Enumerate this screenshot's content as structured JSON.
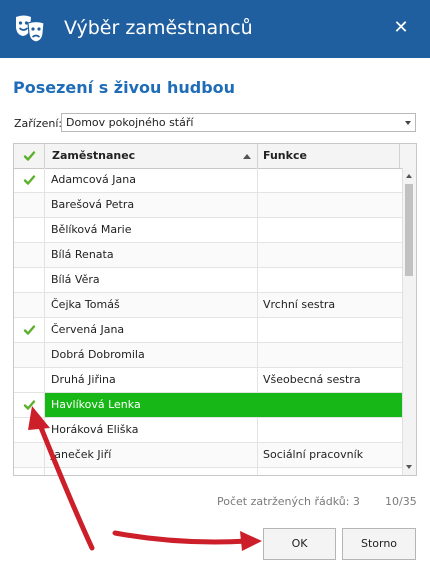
{
  "window": {
    "title": "Výběr zaměstnanců",
    "icon": "theater-masks-icon",
    "close_glyph": "✕"
  },
  "heading": "Posezení s živou hudbou",
  "facility": {
    "label": "Zařízení:",
    "value": "Domov pokojného stáří"
  },
  "table": {
    "columns": {
      "check": "✔",
      "name": "Zaměstnanec",
      "function": "Funkce"
    },
    "sort": {
      "column": "Zaměstnanec",
      "direction": "ascending"
    },
    "rows": [
      {
        "checked": true,
        "name": "Adamcová Jana",
        "function": ""
      },
      {
        "checked": false,
        "name": "Barešová Petra",
        "function": ""
      },
      {
        "checked": false,
        "name": "Bělíková Marie",
        "function": ""
      },
      {
        "checked": false,
        "name": "Bílá Renata",
        "function": ""
      },
      {
        "checked": false,
        "name": "Bílá Věra",
        "function": ""
      },
      {
        "checked": false,
        "name": "Čejka Tomáš",
        "function": "Vrchní sestra"
      },
      {
        "checked": true,
        "name": "Červená Jana",
        "function": ""
      },
      {
        "checked": false,
        "name": "Dobrá Dobromila",
        "function": ""
      },
      {
        "checked": false,
        "name": "Druhá Jiřina",
        "function": "Všeobecná sestra"
      },
      {
        "checked": true,
        "name": "Havlíková Lenka",
        "function": "",
        "selected": true
      },
      {
        "checked": false,
        "name": "Horáková Eliška",
        "function": ""
      },
      {
        "checked": false,
        "name": "Janeček Jiří",
        "function": "Sociální pracovník"
      },
      {
        "checked": false,
        "name": "",
        "function": "",
        "partial": true
      }
    ]
  },
  "status": {
    "checked_label": "Počet zatržených řádků: 3",
    "page_count": "10/35"
  },
  "buttons": {
    "ok": "OK",
    "cancel": "Storno"
  },
  "colors": {
    "titlebar": "#1f5fa0",
    "heading": "#1f6db8",
    "selected_row": "#18b718",
    "checkmark": "#5cb02c",
    "annotation_arrow": "#cc1f2a"
  }
}
